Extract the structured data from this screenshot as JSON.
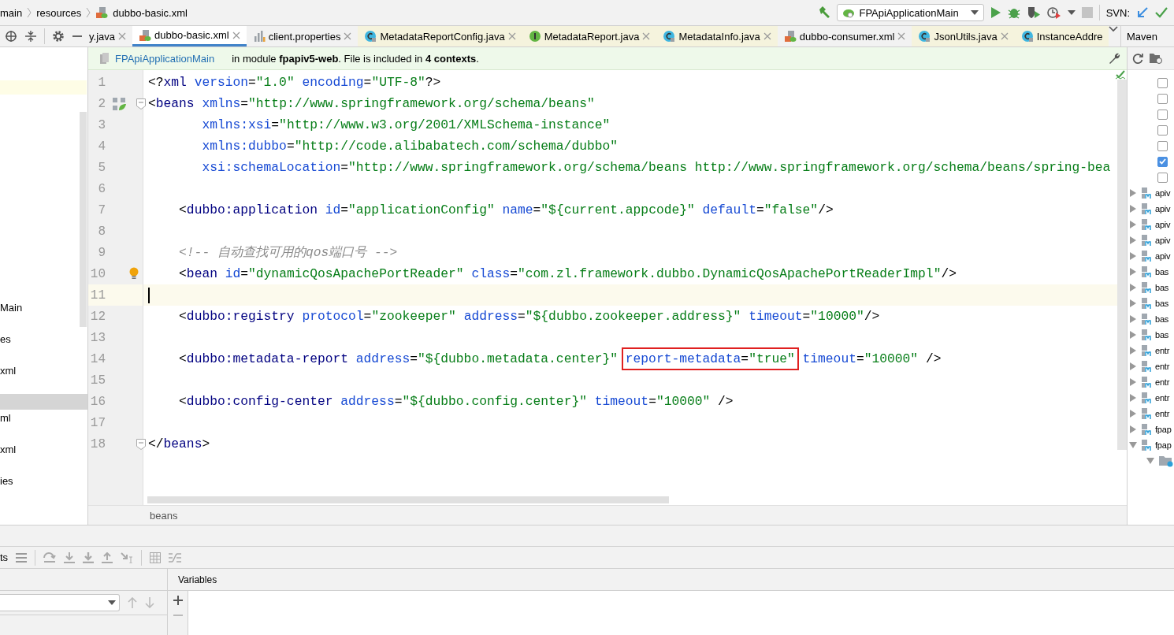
{
  "top_bar": {
    "breadcrumbs": [
      "main",
      "resources",
      "dubbo-basic.xml"
    ],
    "run_config": "FPApiApplicationMain",
    "svn_label": "SVN:"
  },
  "tabs": [
    {
      "label": "y.java",
      "kind": "partial",
      "selected": false
    },
    {
      "label": "dubbo-basic.xml",
      "kind": "xml",
      "selected": true
    },
    {
      "label": "client.properties",
      "kind": "properties",
      "selected": false
    },
    {
      "label": "MetadataReportConfig.java",
      "kind": "class",
      "selected": false
    },
    {
      "label": "MetadataReport.java",
      "kind": "interface",
      "selected": false
    },
    {
      "label": "MetadataInfo.java",
      "kind": "class",
      "selected": false
    },
    {
      "label": "dubbo-consumer.xml",
      "kind": "xml",
      "selected": false
    },
    {
      "label": "JsonUtils.java",
      "kind": "class",
      "selected": false
    },
    {
      "label": "InstanceAddre",
      "kind": "class-cut",
      "selected": false
    }
  ],
  "notification": {
    "link": "FPApiApplicationMain",
    "message": "in module **fpapiv5-web**. File is included in **4 contexts**."
  },
  "editor": {
    "lines": [
      {
        "number": "1",
        "kind": "plain",
        "current": false,
        "fold": false,
        "tokens": [
          {
            "kind": "plain",
            "text": "<?"
          },
          {
            "kind": "tag",
            "text": "xml"
          },
          {
            "kind": "attr",
            "text": " version"
          },
          {
            "kind": "plain",
            "text": "="
          },
          {
            "kind": "val",
            "text": "\"1.0\""
          },
          {
            "kind": "attr",
            "text": " encoding"
          },
          {
            "kind": "plain",
            "text": "="
          },
          {
            "kind": "val",
            "text": "\"UTF-8\""
          },
          {
            "kind": "plain",
            "text": "?>"
          }
        ]
      },
      {
        "number": "2",
        "kind": "bean",
        "current": false,
        "fold": true,
        "tokens": [
          {
            "kind": "plain",
            "text": "<"
          },
          {
            "kind": "tag",
            "text": "beans"
          },
          {
            "kind": "attr",
            "text": " xmlns"
          },
          {
            "kind": "plain",
            "text": "="
          },
          {
            "kind": "val",
            "text": "\"http://www.springframework.org/schema/beans\""
          }
        ]
      },
      {
        "number": "3",
        "kind": "plain",
        "current": false,
        "fold": false,
        "tokens": [
          {
            "kind": "attr",
            "text": "       xmlns:xsi"
          },
          {
            "kind": "plain",
            "text": "="
          },
          {
            "kind": "val",
            "text": "\"http://www.w3.org/2001/XMLSchema-instance\""
          }
        ]
      },
      {
        "number": "4",
        "kind": "plain",
        "current": false,
        "fold": false,
        "tokens": [
          {
            "kind": "attr",
            "text": "       xmlns:dubbo"
          },
          {
            "kind": "plain",
            "text": "="
          },
          {
            "kind": "val",
            "text": "\"http://code.alibabatech.com/schema/dubbo\""
          }
        ]
      },
      {
        "number": "5",
        "kind": "plain",
        "current": false,
        "fold": false,
        "tokens": [
          {
            "kind": "attr",
            "text": "       xsi:schemaLocation"
          },
          {
            "kind": "plain",
            "text": "="
          },
          {
            "kind": "val",
            "text": "\"http://www.springframework.org/schema/beans http://www.springframework.org/schema/beans/spring-bea"
          }
        ]
      },
      {
        "number": "6",
        "kind": "plain",
        "current": false,
        "fold": false
      },
      {
        "number": "7",
        "kind": "plain",
        "current": false,
        "fold": false,
        "tokens": [
          {
            "kind": "plain",
            "text": "    <"
          },
          {
            "kind": "tag",
            "text": "dubbo:application"
          },
          {
            "kind": "attr",
            "text": " id"
          },
          {
            "kind": "plain",
            "text": "="
          },
          {
            "kind": "val",
            "text": "\"applicationConfig\""
          },
          {
            "kind": "attr",
            "text": " name"
          },
          {
            "kind": "plain",
            "text": "="
          },
          {
            "kind": "val",
            "text": "\"${current.appcode}\""
          },
          {
            "kind": "attr",
            "text": " default"
          },
          {
            "kind": "plain",
            "text": "="
          },
          {
            "kind": "val",
            "text": "\"false\""
          },
          {
            "kind": "plain",
            "text": "/>"
          }
        ]
      },
      {
        "number": "8",
        "kind": "plain",
        "current": false,
        "fold": false
      },
      {
        "number": "9",
        "kind": "plain",
        "current": false,
        "fold": false,
        "tokens": [
          {
            "kind": "comment",
            "text": "    <!-- 自动查找可用的qos端口号 -->"
          }
        ]
      },
      {
        "number": "10",
        "kind": "bulb",
        "current": false,
        "fold": false,
        "tokens": [
          {
            "kind": "plain",
            "text": "    <"
          },
          {
            "kind": "tag",
            "text": "bean"
          },
          {
            "kind": "attr",
            "text": " id"
          },
          {
            "kind": "plain",
            "text": "="
          },
          {
            "kind": "val",
            "text": "\"dynamicQosApachePortReader\""
          },
          {
            "kind": "attr",
            "text": " class"
          },
          {
            "kind": "plain",
            "text": "="
          },
          {
            "kind": "val",
            "text": "\"com.zl.framework.dubbo.DynamicQosApachePortReaderImpl\""
          },
          {
            "kind": "plain",
            "text": "/>"
          }
        ]
      },
      {
        "number": "11",
        "kind": "plain",
        "current": true,
        "fold": false
      },
      {
        "number": "12",
        "kind": "plain",
        "current": false,
        "fold": false,
        "tokens": [
          {
            "kind": "plain",
            "text": "    <"
          },
          {
            "kind": "tag",
            "text": "dubbo:registry"
          },
          {
            "kind": "attr",
            "text": " protocol"
          },
          {
            "kind": "plain",
            "text": "="
          },
          {
            "kind": "val",
            "text": "\"zookeeper\""
          },
          {
            "kind": "attr",
            "text": " address"
          },
          {
            "kind": "plain",
            "text": "="
          },
          {
            "kind": "val",
            "text": "\"${dubbo.zookeeper.address}\""
          },
          {
            "kind": "attr",
            "text": " timeout"
          },
          {
            "kind": "plain",
            "text": "="
          },
          {
            "kind": "val",
            "text": "\"10000\""
          },
          {
            "kind": "plain",
            "text": "/>"
          }
        ]
      },
      {
        "number": "13",
        "kind": "plain",
        "current": false,
        "fold": false
      },
      {
        "number": "14",
        "kind": "plain",
        "current": false,
        "fold": false,
        "tokens": [
          {
            "kind": "plain",
            "text": "    <"
          },
          {
            "kind": "tag",
            "text": "dubbo:metadata-report"
          },
          {
            "kind": "attr",
            "text": " address"
          },
          {
            "kind": "plain",
            "text": "="
          },
          {
            "kind": "val",
            "text": "\"${dubbo.metadata.center}\""
          },
          {
            "kind": "box",
            "tokens": [
              {
                "kind": "attr",
                "text": "report-metadata"
              },
              {
                "kind": "plain",
                "text": "="
              },
              {
                "kind": "val",
                "text": "\"true\""
              }
            ]
          },
          {
            "kind": "attr",
            "text": " timeout"
          },
          {
            "kind": "plain",
            "text": "="
          },
          {
            "kind": "val",
            "text": "\"10000\""
          },
          {
            "kind": "plain",
            "text": " />"
          }
        ]
      },
      {
        "number": "15",
        "kind": "plain",
        "current": false,
        "fold": false
      },
      {
        "number": "16",
        "kind": "plain",
        "current": false,
        "fold": false,
        "tokens": [
          {
            "kind": "plain",
            "text": "    <"
          },
          {
            "kind": "tag",
            "text": "dubbo:config-center"
          },
          {
            "kind": "attr",
            "text": " address"
          },
          {
            "kind": "plain",
            "text": "="
          },
          {
            "kind": "val",
            "text": "\"${dubbo.config.center}\""
          },
          {
            "kind": "attr",
            "text": " timeout"
          },
          {
            "kind": "plain",
            "text": "="
          },
          {
            "kind": "val",
            "text": "\"10000\""
          },
          {
            "kind": "plain",
            "text": " />"
          }
        ]
      },
      {
        "number": "17",
        "kind": "plain",
        "current": false,
        "fold": false
      },
      {
        "number": "18",
        "kind": "plain",
        "current": false,
        "fold": true,
        "tokens": [
          {
            "kind": "plain",
            "text": "</"
          },
          {
            "kind": "tag",
            "text": "beans"
          },
          {
            "kind": "plain",
            "text": ">"
          }
        ]
      }
    ],
    "breadcrumb": "beans"
  },
  "project_panel": {
    "items": [
      {
        "text": "Main",
        "selected": false
      },
      {
        "text": "es",
        "selected": false
      },
      {
        "text": "xml",
        "selected": false
      },
      {
        "selected": true
      },
      {
        "text": "ml",
        "selected": false
      },
      {
        "text": "xml",
        "selected": false
      },
      {
        "text": "ies",
        "selected": false
      }
    ]
  },
  "maven": {
    "title": "Maven",
    "options": [
      {
        "checked": false
      },
      {
        "checked": false
      },
      {
        "checked": false
      },
      {
        "checked": false
      },
      {
        "checked": false
      },
      {
        "checked": true
      },
      {
        "checked": false
      }
    ],
    "modules": [
      {
        "label": "apiv",
        "expanded": false
      },
      {
        "label": "apiv",
        "expanded": false
      },
      {
        "label": "apiv",
        "expanded": false
      },
      {
        "label": "apiv",
        "expanded": false
      },
      {
        "label": "apiv",
        "expanded": false
      },
      {
        "label": "bas",
        "expanded": false
      },
      {
        "label": "bas",
        "expanded": false
      },
      {
        "label": "bas",
        "expanded": false
      },
      {
        "label": "bas",
        "expanded": false
      },
      {
        "label": "bas",
        "expanded": false
      },
      {
        "label": "entr",
        "expanded": false
      },
      {
        "label": "entr",
        "expanded": false
      },
      {
        "label": "entr",
        "expanded": false
      },
      {
        "label": "entr",
        "expanded": false
      },
      {
        "label": "entr",
        "expanded": false
      },
      {
        "label": "fpap",
        "expanded": false
      },
      {
        "label": "fpap",
        "expanded": true
      }
    ]
  },
  "debug": {
    "partial_label": "ts",
    "variables_title": "Variables"
  }
}
